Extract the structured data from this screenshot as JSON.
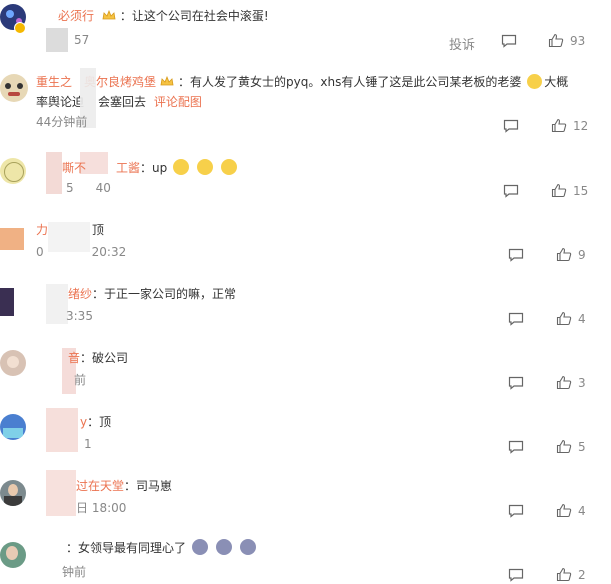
{
  "comments": [
    {
      "name": "必须行",
      "text": "让这个公司在社会中滚蛋!",
      "time": "57",
      "report": "投诉",
      "likes": "93"
    },
    {
      "name_a": "重生之",
      "name_b": "奥尔良烤鸡堡",
      "text_a": "有人发了黄女士的pyq。xhs有人锤了这是此公司某老板的老婆",
      "text_b_pre": "大概",
      "text_b": "率舆论迫",
      "text_b2": "会塞回去",
      "link": "评论配图",
      "time": "44分钟前",
      "likes": "12"
    },
    {
      "name": "嘶不",
      "name_b": "工酱",
      "text": "up",
      "time_a": "5",
      "time_b": "40",
      "likes": "15"
    },
    {
      "name": "力",
      "text": "顶",
      "time_a": "0",
      "time_b": "20:32",
      "likes": "9"
    },
    {
      "name": "绪纱",
      "text": "于正一家公司的嘛，正常",
      "time": "3:35",
      "likes": "4"
    },
    {
      "name": "音",
      "text": "破公司",
      "time": "前",
      "likes": "3"
    },
    {
      "name": "y",
      "text": "顶",
      "time": "1",
      "likes": "5"
    },
    {
      "name": "过在天堂",
      "text": "司马崽",
      "time": "日 18:00",
      "likes": "4"
    },
    {
      "name": "",
      "text": "女领导最有同理心了",
      "time": "钟前",
      "likes": "2"
    }
  ]
}
